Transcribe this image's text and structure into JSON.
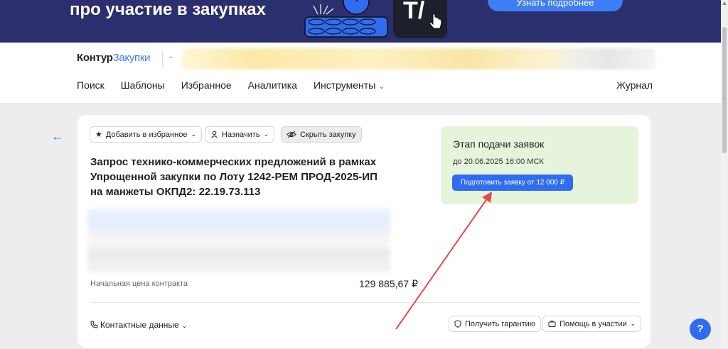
{
  "banner": {
    "title": "про участие в закупках",
    "tile_text": "T/",
    "button_label": "Узнать подробнее"
  },
  "header": {
    "logo_part1": "Контур",
    "logo_part2": "Закупки",
    "nav": [
      {
        "label": "Поиск"
      },
      {
        "label": "Шаблоны"
      },
      {
        "label": "Избранное"
      },
      {
        "label": "Аналитика"
      },
      {
        "label": "Инструменты"
      }
    ],
    "nav_right": "Журнал"
  },
  "card": {
    "actions": {
      "favorite": "Добавить в избранное",
      "assign": "Назначить",
      "hide": "Скрыть закупку"
    },
    "title": "Запрос технико-коммерческих предложений в рамках Упрощенной закупки по Лоту 1242-РЕМ ПРОД-2025-ИП на манжеты ОКПД2: 22.19.73.113",
    "price_label": "Начальная цена контракта",
    "price_value": "129 885,67 ₽",
    "contacts": "Контактные данные",
    "guarantee_button": "Получить гарантию",
    "help_button": "Помощь в участии"
  },
  "stage": {
    "title": "Этап подачи заявок",
    "date": "до 20.06.2025 16:00 МСК",
    "button": "Подготовить заявку от 12 000 ₽"
  },
  "help_fab": "?",
  "colors": {
    "accent": "#2f6cf0",
    "banner_bg": "#2c2f6e",
    "stage_bg": "#e6f4dc",
    "annotation": "#e84a4a"
  }
}
